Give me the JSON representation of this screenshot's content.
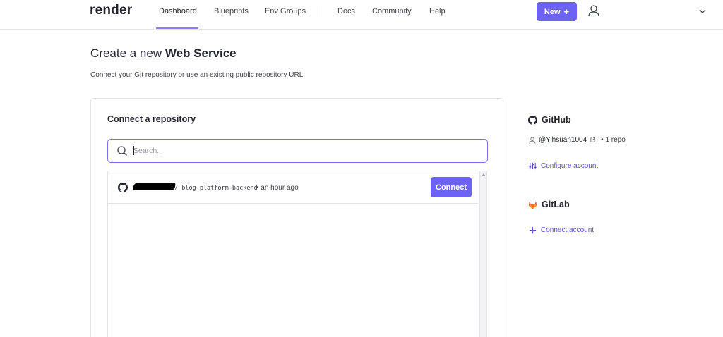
{
  "nav": {
    "logo": "render",
    "links": [
      "Dashboard",
      "Blueprints",
      "Env Groups",
      "Docs",
      "Community",
      "Help"
    ],
    "new_button": "New",
    "new_plus": "+"
  },
  "page": {
    "title_prefix": "Create a new ",
    "title_bold": "Web Service",
    "subtitle": "Connect your Git repository or use an existing public repository URL."
  },
  "card": {
    "title": "Connect a repository",
    "search_placeholder": "Search...",
    "repos": [
      {
        "name": "/ blog-platform-backend",
        "time": "• an hour ago",
        "action": "Connect"
      }
    ]
  },
  "sidebar": {
    "github": {
      "heading": "GitHub",
      "account": "@Yihsuan1004",
      "repo_count": "• 1 repo",
      "configure": "Configure account"
    },
    "gitlab": {
      "heading": "GitLab",
      "connect": "Connect account"
    }
  },
  "colors": {
    "accent": "#6c63f5",
    "link": "#5b4fd9",
    "gitlab_orange": "#e24329"
  }
}
